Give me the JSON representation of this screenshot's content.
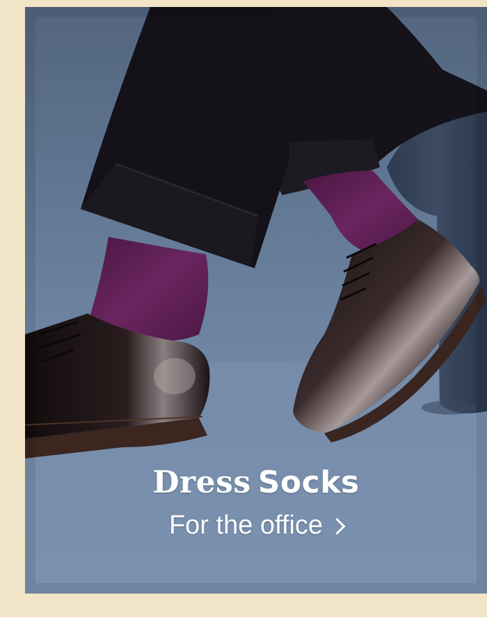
{
  "banner": {
    "headline_word_1": "Dress",
    "headline_word_2": "Socks",
    "cta_label": "For the office",
    "cta_icon": "chevron-right-icon"
  },
  "colors": {
    "background": "#f2e4c6",
    "photo_backdrop": "#6f87a4",
    "sock": "#5e1f53",
    "shoe": "#1d1414",
    "trousers": "#151219",
    "text": "#ffffff"
  }
}
